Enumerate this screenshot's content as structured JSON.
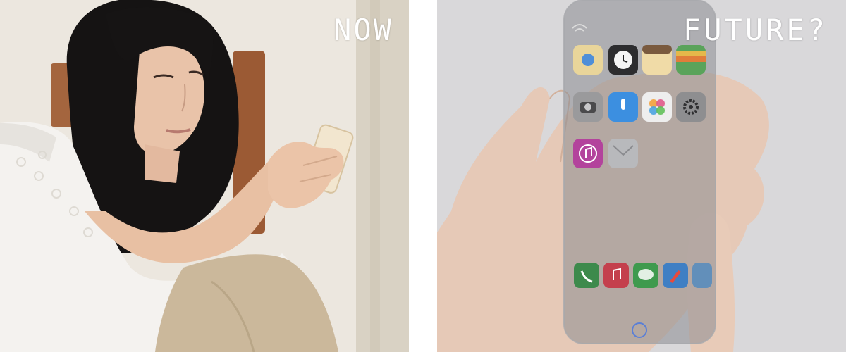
{
  "panels": {
    "now": {
      "caption": "NOW"
    },
    "future": {
      "caption": "FUTURE?"
    }
  },
  "colors": {
    "now_background": "#ece7df",
    "future_background": "#d8d7d9",
    "caption": "#ffffff"
  },
  "icons": {
    "future_app_grid": [
      "maps-icon",
      "clock-icon",
      "notes-icon",
      "wallet-icon",
      "camera-icon",
      "voice-memo-icon",
      "photos-icon",
      "settings-icon",
      "music-icon",
      "mail-icon"
    ],
    "future_dock": [
      "phone-icon",
      "music-icon",
      "messages-icon",
      "safari-icon",
      "home-button-icon"
    ]
  }
}
